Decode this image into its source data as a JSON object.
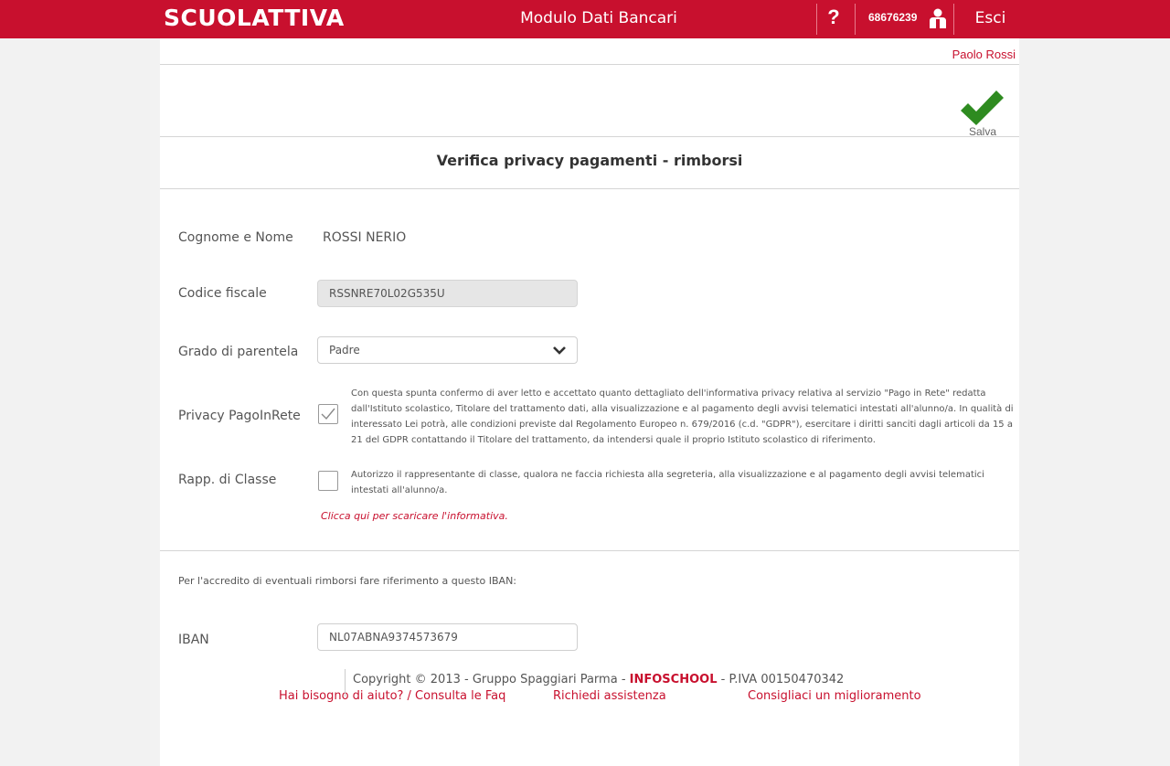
{
  "header": {
    "logo": "SCUOLATTIVA",
    "title": "Modulo Dati Bancari",
    "help_label": "?",
    "user_code": "68676239",
    "logout_label": "Esci"
  },
  "user": {
    "name": "Paolo Rossi"
  },
  "toolbar": {
    "save_label": "Salva"
  },
  "section": {
    "title": "Verifica privacy pagamenti - rimborsi"
  },
  "form": {
    "name_label": "Cognome e Nome",
    "name_value": "ROSSI NERIO",
    "fiscal_label": "Codice fiscale",
    "fiscal_value": "RSSNRE70L02G535U",
    "relation_label": "Grado di parentela",
    "relation_value": "Padre",
    "privacy_label": "Privacy PagoInRete",
    "privacy_checked": true,
    "privacy_text": "Con questa spunta confermo di aver letto e accettato quanto dettagliato dell'informativa privacy relativa al servizio \"Pago in Rete\" redatta dall'Istituto scolastico, Titolare del trattamento dati, alla visualizzazione e al pagamento degli avvisi telematici intestati all'alunno/a. In qualità di interessato Lei potrà, alle condizioni previste dal Regolamento Europeo n. 679/2016 (c.d. \"GDPR\"), esercitare i diritti sanciti dagli articoli da 15 a 21 del GDPR contattando il Titolare del trattamento, da intendersi quale il proprio Istituto scolastico di riferimento.",
    "rep_label": "Rapp. di Classe",
    "rep_checked": false,
    "rep_text": "Autorizzo il rappresentante di classe, qualora ne faccia richiesta alla segreteria, alla visualizzazione e al pagamento degli avvisi telematici intestati all'alunno/a.",
    "download_link": "Clicca qui per scaricare l'informativa.",
    "iban_note": "Per l'accredito di eventuali rimborsi fare riferimento a questo IBAN:",
    "iban_label": "IBAN",
    "iban_value": "NL07ABNA9374573679"
  },
  "footer": {
    "faq_link": "Hai bisogno di aiuto? / Consulta le Faq",
    "assist_link": "Richiedi assistenza",
    "suggest_link": "Consigliaci un miglioramento",
    "copyright_prefix": "Copyright © 2013 - Gruppo Spaggiari Parma -",
    "copyright_brand": "INFOSCHOOL",
    "copyright_suffix": "- P.IVA 00150470342"
  },
  "colors": {
    "brand": "#c8102e",
    "accent_green": "#2e8b20"
  },
  "icons": [
    "help-icon",
    "user-icon",
    "checkmark-icon",
    "chevron-down-icon",
    "check-icon"
  ]
}
